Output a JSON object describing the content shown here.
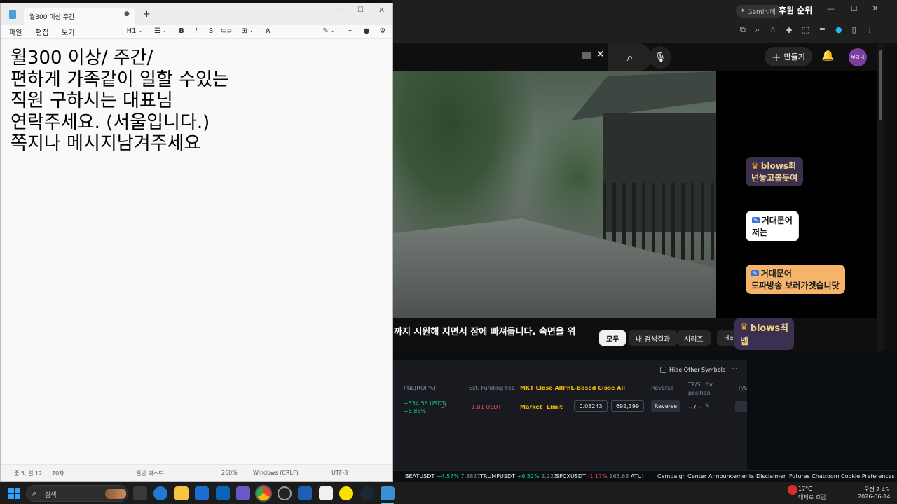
{
  "notepad": {
    "tab_title": "월300 이상 주간",
    "menu": {
      "file": "파일",
      "edit": "편집",
      "view": "보기"
    },
    "toolbar": {
      "heading": "H1"
    },
    "content_lines": [
      "월300 이상/ 주간/",
      "편하게 가족같이 일할 수있는",
      "직원 구하시는 대표님",
      "연락주세요. (서울입니다.)",
      "쪽지나 메시지남겨주세요"
    ],
    "status": {
      "position": "줄 5, 열 12",
      "chars": "70자",
      "format": "일반 텍스트",
      "zoom": "260%",
      "line_ending": "Windows (CRLF)",
      "encoding": "UTF-8"
    }
  },
  "browser": {
    "top_tab": "Gemini에",
    "overlay_title": "후원 순위",
    "create_label": "만들기",
    "avatar_label": "무과금",
    "video_caption": "까지 시원해 지면서 잠에 빠져듭니다. 숙면을 위",
    "filter_chips": [
      "모두",
      "내 검색결과",
      "시리즈",
      "He"
    ],
    "chat": [
      {
        "name": "blows최",
        "msg": "넌놓고볼듯여"
      },
      {
        "name": "거대문어",
        "msg": "저는"
      },
      {
        "name": "거대문어",
        "msg": "도파방송 보러가겟습니닷"
      },
      {
        "name": "blows최",
        "msg": "넵"
      }
    ]
  },
  "trading": {
    "hide_other": "Hide Other Symbols",
    "headers": {
      "pnl": "PNL(ROI %)",
      "funding": "Est. Funding Fee",
      "mkt_close": "MKT Close All",
      "pnl_close": "PnL-Based Close All",
      "reverse": "Reverse",
      "tpsl": "TP/SL for position",
      "tps": "TP/S"
    },
    "row": {
      "pnl": "+534.56 USDT",
      "roi": "+5.88%",
      "funding": "-1.81 USDT",
      "market": "Market",
      "limit": "Limit",
      "price": "0.05243",
      "qty": "692,399",
      "reverse_btn": "Reverse",
      "tpsl": "-- / --"
    },
    "tickers": [
      {
        "sym": "BEATUSDT",
        "chg": "+4.57%",
        "px": "7.3827"
      },
      {
        "sym": "TRUMPUSDT",
        "chg": "+6.52%",
        "px": "2.221"
      },
      {
        "sym": "SPCXUSDT",
        "chg": "-1.17%",
        "px": "165.63"
      },
      {
        "sym": "ATU!",
        "chg": "",
        "px": ""
      }
    ],
    "footer_links": [
      "Campaign Center",
      "Announcements",
      "Disclaimer",
      "Futures Chatroom",
      "Cookie Preferences"
    ]
  },
  "taskbar": {
    "search": "검색",
    "weather_temp": "17°C",
    "weather_desc": "대체로 흐림",
    "time": "오전 7:45",
    "date": "2026-06-14"
  },
  "colors": {
    "accent_blue": "#0078d4",
    "up_green": "#0ecb81",
    "down_red": "#f6465d",
    "gold": "#f0b90b"
  }
}
